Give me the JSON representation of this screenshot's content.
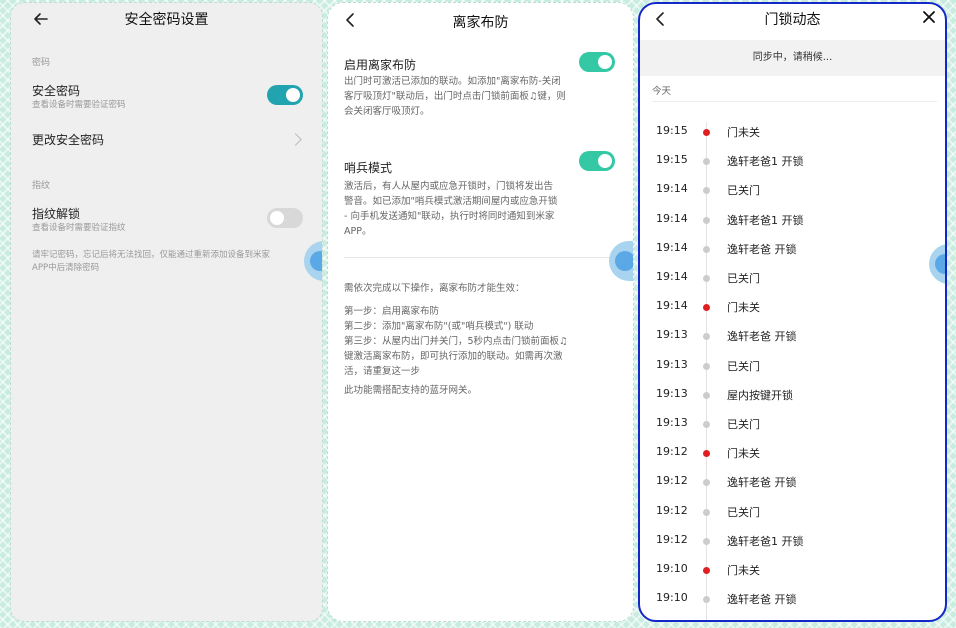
{
  "colors": {
    "toggle_teal": "#22a3b0",
    "toggle_green": "#34c8a4",
    "dot_red": "#e02020",
    "dot_gray": "#cccccc",
    "focus_border": "#1428c8"
  },
  "p1": {
    "title": "安全密码设置",
    "section_password": "密码",
    "safe_password_title": "安全密码",
    "safe_password_desc": "查看设备时需要验证密码",
    "safe_password_on": true,
    "change_password": "更改安全密码",
    "section_fingerprint": "指纹",
    "fingerprint_title": "指纹解锁",
    "fingerprint_desc": "查看设备时需要验证指纹",
    "fingerprint_on": false,
    "note_1": "请牢记密码，忘记后将无法找回，仅能通过重新添加设备到米家",
    "note_2": "APP中后清除密码"
  },
  "p2": {
    "title": "离家布防",
    "away_title": "启用离家布防",
    "away_on": true,
    "away_desc_1": "出门时可激活已添加的联动。如添加\"离家布防-关闭",
    "away_desc_2": "客厅吸顶灯\"联动后，出门时点击门锁前面板♫键，则",
    "away_desc_3": "会关闭客厅吸顶灯。",
    "sentry_title": "哨兵模式",
    "sentry_on": true,
    "sentry_desc_1": "激活后，有人从屋内或应急开锁时，门锁将发出告",
    "sentry_desc_2": "警音。如已添加\"哨兵模式激活期间屋内或应急开锁",
    "sentry_desc_3": "- 向手机发送通知\"联动，执行时将同时通知到米家",
    "sentry_desc_4": "APP。",
    "steps_intro": "需依次完成以下操作，离家布防才能生效：",
    "step_1": "第一步：启用离家布防",
    "step_2": "第二步：添加\"离家布防\"(或\"哨兵模式\") 联动",
    "step_3a": "第三步：从屋内出门并关门，5秒内点击门锁前面板♫",
    "step_3b": "键激活离家布防，即可执行添加的联动。如需再次激",
    "step_3c": "活，请重复这一步",
    "gateway_note": "此功能需搭配支持的蓝牙网关。"
  },
  "p3": {
    "title": "门锁动态",
    "sync": "同步中，请稍候...",
    "today": "今天",
    "events": [
      {
        "time": "19:15",
        "text": "门未关",
        "alert": true
      },
      {
        "time": "19:15",
        "text": "逸轩老爸1 开锁",
        "alert": false
      },
      {
        "time": "19:14",
        "text": "已关门",
        "alert": false
      },
      {
        "time": "19:14",
        "text": "逸轩老爸1 开锁",
        "alert": false
      },
      {
        "time": "19:14",
        "text": "逸轩老爸 开锁",
        "alert": false
      },
      {
        "time": "19:14",
        "text": "已关门",
        "alert": false
      },
      {
        "time": "19:14",
        "text": "门未关",
        "alert": true
      },
      {
        "time": "19:13",
        "text": "逸轩老爸 开锁",
        "alert": false
      },
      {
        "time": "19:13",
        "text": "已关门",
        "alert": false
      },
      {
        "time": "19:13",
        "text": "屋内按键开锁",
        "alert": false
      },
      {
        "time": "19:13",
        "text": "已关门",
        "alert": false
      },
      {
        "time": "19:12",
        "text": "门未关",
        "alert": true
      },
      {
        "time": "19:12",
        "text": "逸轩老爸 开锁",
        "alert": false
      },
      {
        "time": "19:12",
        "text": "已关门",
        "alert": false
      },
      {
        "time": "19:12",
        "text": "逸轩老爸1 开锁",
        "alert": false
      },
      {
        "time": "19:10",
        "text": "门未关",
        "alert": true
      },
      {
        "time": "19:10",
        "text": "逸轩老爸 开锁",
        "alert": false
      }
    ]
  }
}
